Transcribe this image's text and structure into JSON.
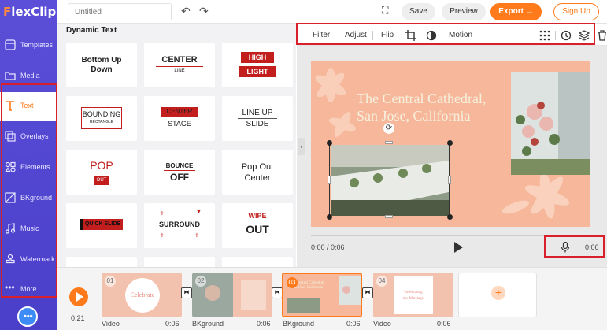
{
  "app": {
    "logo_main": "lexClip",
    "logo_f": "F"
  },
  "sidebar": {
    "items": [
      {
        "label": "Templates"
      },
      {
        "label": "Media"
      },
      {
        "label": "Text"
      },
      {
        "label": "Overlays"
      },
      {
        "label": "Elements"
      },
      {
        "label": "BKground"
      },
      {
        "label": "Music"
      },
      {
        "label": "Watermark"
      },
      {
        "label": "More"
      }
    ],
    "active": "Text",
    "help_icon": "chat-bubble-icon"
  },
  "topbar": {
    "title_placeholder": "Untitled",
    "save_label": "Save",
    "preview_label": "Preview",
    "export_label": "Export",
    "export_arrow": "→",
    "signup_label": "Sign Up"
  },
  "panel": {
    "title": "Dynamic Text",
    "cards": [
      {
        "t1": "Bottom Up",
        "t2": "Down"
      },
      {
        "t1": "CENTER",
        "t2": "LINE"
      },
      {
        "t1": "HIGH",
        "t2": "LIGHT"
      },
      {
        "t1": "BOUNDING",
        "t2": "RECTANGLE"
      },
      {
        "t1": "CENTER",
        "t2": "STAGE"
      },
      {
        "t1": "LINE UP",
        "t2": "SLIDE"
      },
      {
        "t1": "POP",
        "t2": "OUT"
      },
      {
        "t1": "BOUNCE",
        "t2": "OFF"
      },
      {
        "t1": "Pop Out",
        "t2": "Center"
      },
      {
        "t1": "QUICK SLIDE",
        "t2": ""
      },
      {
        "t1": "SURROUND",
        "t2": ""
      },
      {
        "t1": "WIPE",
        "t2": "OUT"
      }
    ]
  },
  "toolbar": {
    "filter": "Filter",
    "adjust": "Adjust",
    "flip": "Flip",
    "motion": "Motion"
  },
  "canvas": {
    "title_line1": "The Central Cathedral,",
    "title_line2": "San Jose, California"
  },
  "player": {
    "current_time": "0:00 / 0:06",
    "total_time": "0:06"
  },
  "timeline": {
    "time": "0:21",
    "clips": [
      {
        "num": "01",
        "label": "Video",
        "duration": "0:06"
      },
      {
        "num": "02",
        "label": "BKground",
        "duration": "0:06"
      },
      {
        "num": "03",
        "label": "BKground",
        "duration": "0:06"
      },
      {
        "num": "04",
        "label": "Video",
        "duration": "0:06"
      }
    ],
    "add_label": "+"
  },
  "colors": {
    "accent": "#ff7a1a",
    "sidebar": "#4a3fc9",
    "highlight": "#d8202a",
    "slide_bg": "#f6b79a"
  }
}
